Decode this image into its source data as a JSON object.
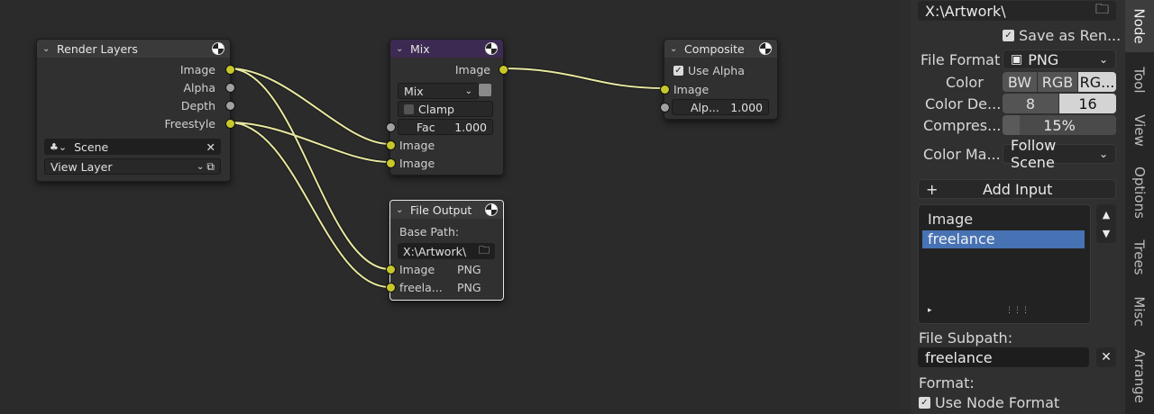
{
  "nodes": {
    "render_layers": {
      "title": "Render Layers",
      "outputs": [
        "Image",
        "Alpha",
        "Depth",
        "Freestyle"
      ],
      "scene": "Scene",
      "view_layer": "View Layer"
    },
    "mix": {
      "title": "Mix",
      "output": "Image",
      "blend_mode": "Mix",
      "clamp_label": "Clamp",
      "fac_label": "Fac",
      "fac_value": "1.000",
      "inputs": [
        "Image",
        "Image"
      ]
    },
    "composite": {
      "title": "Composite",
      "use_alpha_label": "Use Alpha",
      "input": "Image",
      "alpha_label": "Alp...",
      "alpha_value": "1.000"
    },
    "file_output": {
      "title": "File Output",
      "base_path_label": "Base Path:",
      "base_path": "X:\\Artwork\\",
      "inputs": [
        {
          "name": "Image",
          "format": "PNG"
        },
        {
          "name": "freela...",
          "format": "PNG"
        }
      ]
    }
  },
  "sidebar": {
    "path": "X:\\Artwork\\",
    "save_as_render": "Save as Ren...",
    "file_format_label": "File Format",
    "file_format": "PNG",
    "color_label": "Color",
    "color_options": [
      "BW",
      "RGB",
      "RG..."
    ],
    "color_depth_label": "Color De...",
    "color_depth_options": [
      "8",
      "16"
    ],
    "compression_label": "Compres...",
    "compression_value": "15%",
    "color_management_label": "Color Ma...",
    "color_management_value": "Follow Scene",
    "add_input": "Add Input",
    "inputs_list": [
      "Image",
      "freelance"
    ],
    "file_subpath_label": "File Subpath:",
    "file_subpath": "freelance",
    "format_label": "Format:",
    "use_node_format": "Use Node Format"
  },
  "tabs": [
    "Node",
    "Tool",
    "View",
    "Options",
    "Trees",
    "Misc",
    "Arrange"
  ],
  "colors": {
    "link": "#e8e8a0",
    "socket_yellow": "#c7c729",
    "socket_grey": "#a1a1a1",
    "mix_header": "#3d2a52",
    "selected_item": "#4772b3"
  }
}
